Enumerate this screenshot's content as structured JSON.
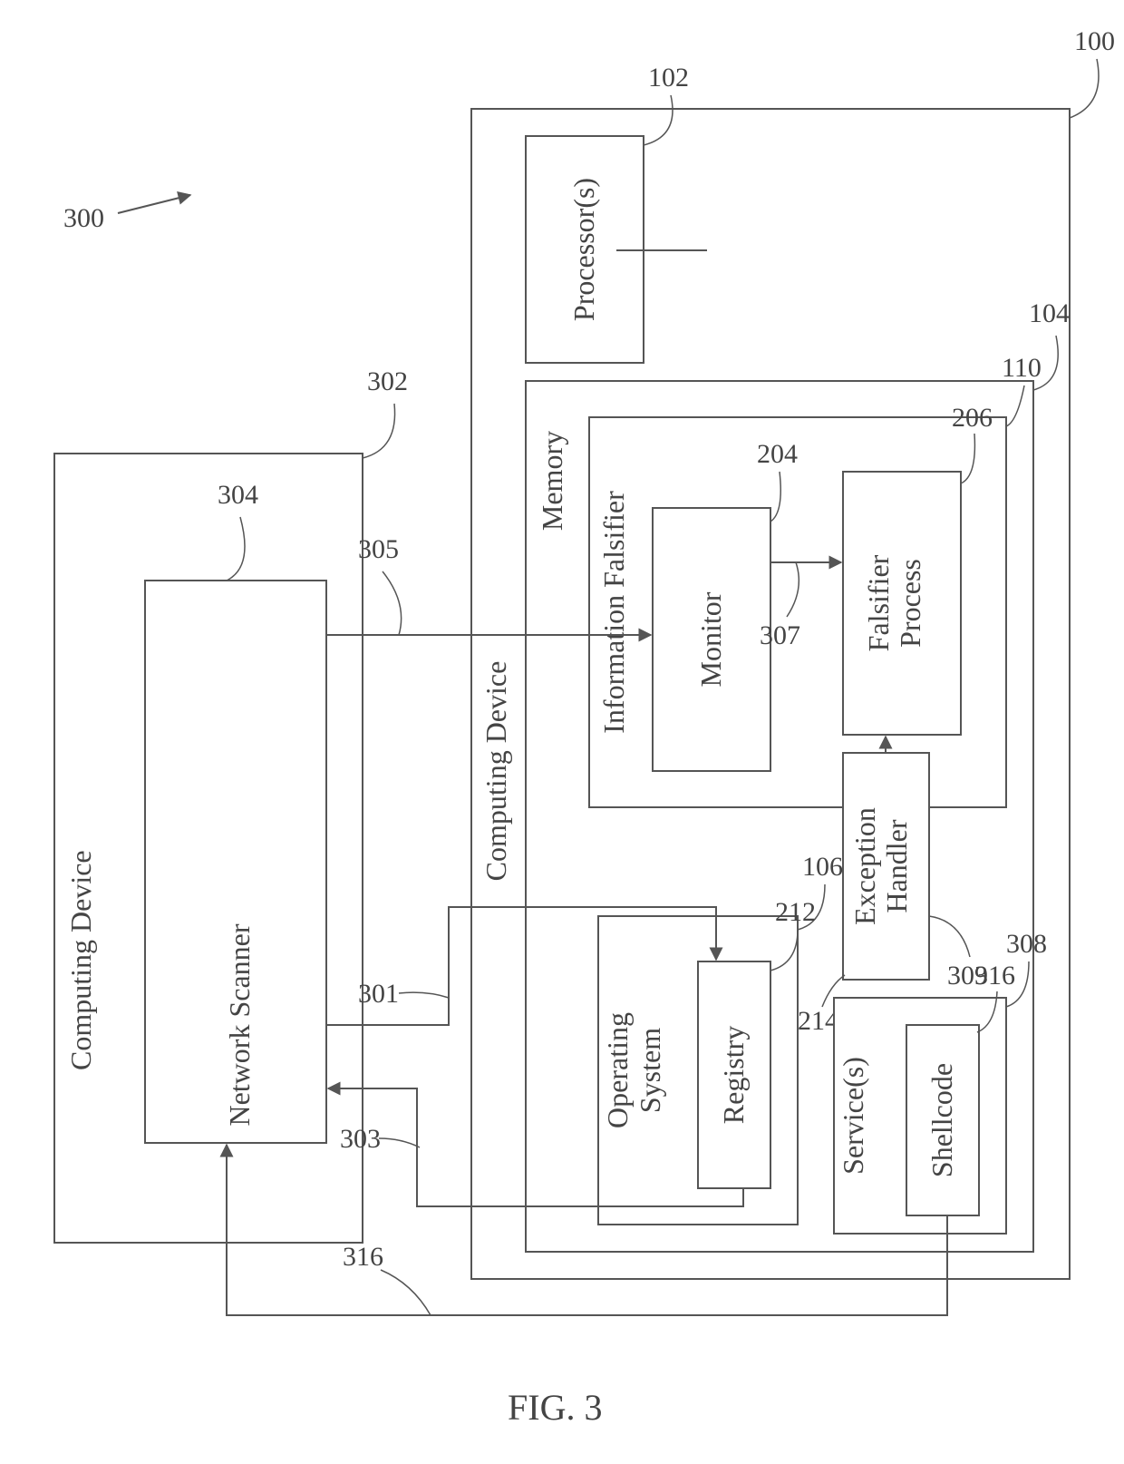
{
  "figure_label": "FIG. 3",
  "overall_ref": "300",
  "device_left": {
    "title": "Computing Device",
    "ref": "302"
  },
  "network_scanner": {
    "title": "Network Scanner",
    "ref": "304"
  },
  "device_right": {
    "title": "Computing Device",
    "ref": "100"
  },
  "processors": {
    "title": "Processor(s)",
    "ref": "102"
  },
  "memory": {
    "title": "Memory",
    "ref": "104"
  },
  "info_falsifier": {
    "title": "Information Falsifier",
    "ref": "110"
  },
  "monitor": {
    "title": "Monitor",
    "ref": "204"
  },
  "falsifier_process": {
    "title": "Falsifier Process",
    "ref": "206"
  },
  "exception_handler": {
    "title": "Exception Handler",
    "ref": "214"
  },
  "operating_system": {
    "title": "Operating System",
    "ref": "106"
  },
  "registry": {
    "title": "Registry",
    "ref": "212"
  },
  "services": {
    "title": "Service(s)",
    "ref": "308"
  },
  "shellcode": {
    "title": "Shellcode",
    "ref": "316"
  },
  "arrows": {
    "scanner_to_monitor": "305",
    "scanner_to_registry": "301",
    "registry_to_scanner": "303",
    "monitor_to_falsifier": "307",
    "handler_to_falsifier": "309",
    "shellcode_to_scanner": "316"
  }
}
